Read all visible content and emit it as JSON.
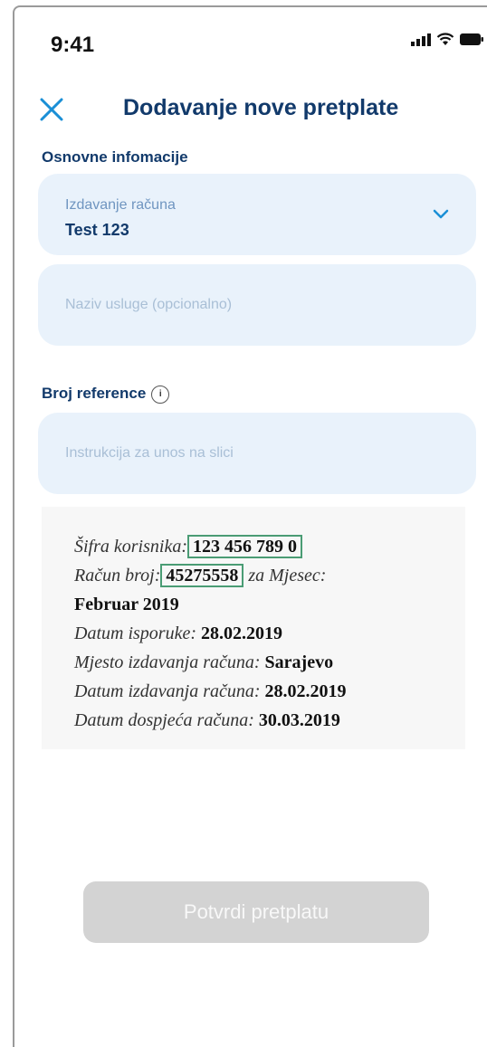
{
  "status_bar": {
    "time": "9:41",
    "icons": [
      "signal-icon",
      "wifi-icon",
      "battery-icon"
    ]
  },
  "header": {
    "close_icon": "close-icon",
    "title": "Dodavanje nove pretplate"
  },
  "sections": {
    "basic_info": "Osnovne infomacije",
    "reference": "Broj reference",
    "reference_info_icon": "info-icon"
  },
  "fields": {
    "issuer": {
      "label": "Izdavanje računa",
      "value": "Test 123",
      "icon": "chevron-down-icon"
    },
    "service_name": {
      "value": "",
      "placeholder": "Naziv usluge (opcionalno)"
    },
    "reference_number": {
      "value": "",
      "placeholder": "Instrukcija za unos na slici"
    }
  },
  "instruction_image": {
    "customer_code_label": "Šifra korisnika:",
    "customer_code": "123 456 789 0",
    "invoice_number_label": "Račun broj:",
    "invoice_number": "45275558",
    "month_label": "za Mjesec:",
    "month_value": "Februar 2019",
    "delivery_date_label": "Datum isporuke:",
    "delivery_date": "28.02.2019",
    "issue_place_label": "Mjesto izdavanja računa:",
    "issue_place": "Sarajevo",
    "issue_date_label": "Datum izdavanja računa:",
    "issue_date": "28.02.2019",
    "due_date_label": "Datum dospjeća računa:",
    "due_date": "30.03.2019"
  },
  "actions": {
    "confirm_label": "Potvrdi pretplatu"
  },
  "colors": {
    "accent": "#1a8fd6",
    "title": "#123a6b",
    "field_background": "#e9f2fb",
    "disabled_button": "#d3d3d3",
    "highlight_box": "#4a9c74"
  }
}
